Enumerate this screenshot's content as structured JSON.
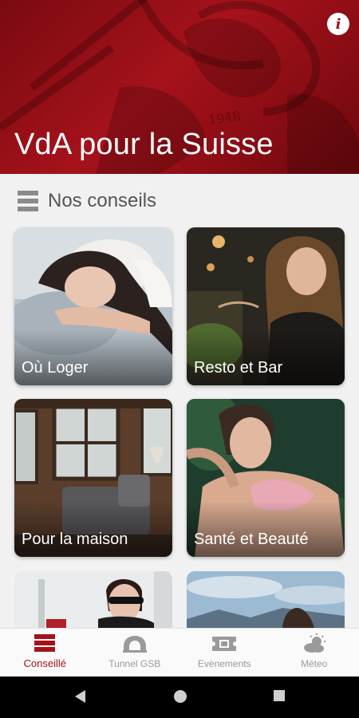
{
  "header": {
    "title": "VdA pour la Suisse",
    "emblem_text": "1948",
    "info_icon": "info-icon"
  },
  "section": {
    "title": "Nos conseils",
    "icon": "list-icon"
  },
  "cards": [
    {
      "label": "Où Loger",
      "image": "sleeping-woman-photo"
    },
    {
      "label": "Resto et Bar",
      "image": "woman-dining-photo"
    },
    {
      "label": "Pour la maison",
      "image": "cabin-interior-photo"
    },
    {
      "label": "Santé et Beauté",
      "image": "woman-in-bath-photo"
    },
    {
      "label": "",
      "image": "woman-sunglasses-photo"
    },
    {
      "label": "",
      "image": "mountain-lake-photo"
    }
  ],
  "bottom_nav": [
    {
      "label": "Conseillé",
      "icon": "list-icon",
      "active": true
    },
    {
      "label": "Tunnel GSB",
      "icon": "tunnel-icon",
      "active": false
    },
    {
      "label": "Evènements",
      "icon": "ticket-icon",
      "active": false
    },
    {
      "label": "Méteo",
      "icon": "weather-icon",
      "active": false
    }
  ],
  "colors": {
    "brand_red": "#a5121b",
    "inactive_gray": "#9a9a9a",
    "background": "#f1f1f1"
  }
}
